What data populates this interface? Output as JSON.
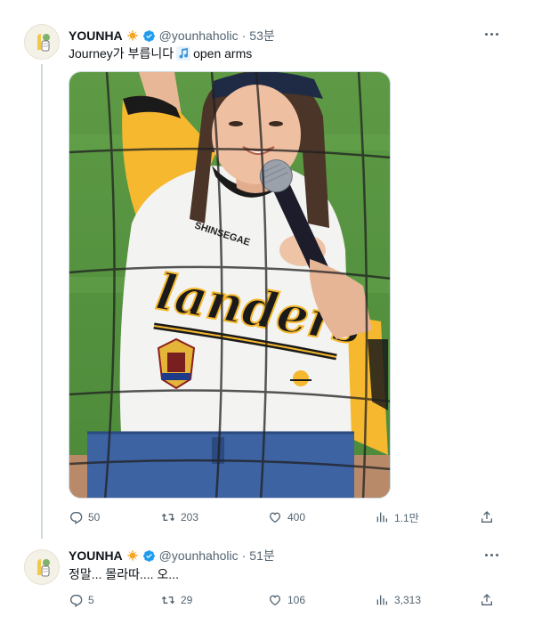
{
  "tweets": [
    {
      "author_name": "YOUNHA",
      "handle": "@younhaholic",
      "separator": "·",
      "time": "53분",
      "text_before": "Journey가 부릅니다",
      "text_after": "open arms",
      "replies": "50",
      "retweets": "203",
      "likes": "400",
      "views": "1.1만",
      "media_jersey_text": "landers",
      "media_sponsor_text": "SHINSEGAE"
    },
    {
      "author_name": "YOUNHA",
      "handle": "@younhaholic",
      "separator": "·",
      "time": "51분",
      "text": "정말... 몰라따.... 오...",
      "replies": "5",
      "retweets": "29",
      "likes": "106",
      "views": "3,313"
    }
  ],
  "colors": {
    "text_primary": "#0f1419",
    "text_secondary": "#536471",
    "verified_blue": "#1d9bf0",
    "badge_orange": "#f5a623",
    "note_blue": "#3b94d9"
  },
  "icons": [
    "avatar-illustration",
    "sun-badge-icon",
    "verified-icon",
    "music-note-icon",
    "more-icon",
    "reply-icon",
    "retweet-icon",
    "like-icon",
    "views-icon",
    "share-icon"
  ]
}
